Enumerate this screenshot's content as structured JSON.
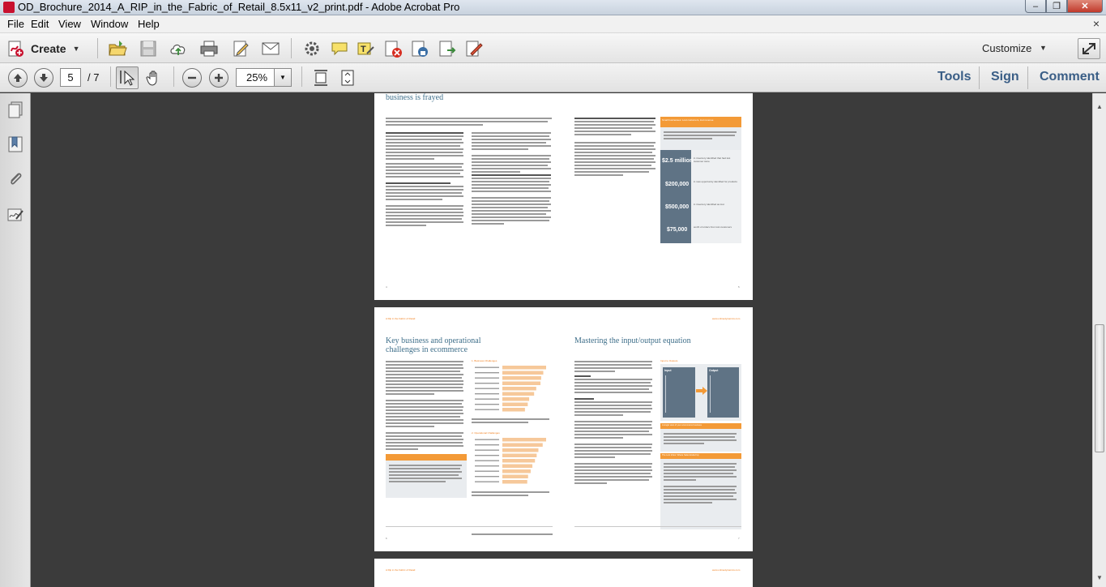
{
  "window": {
    "title": "OD_Brochure_2014_A_RIP_in_the_Fabric_of_Retail_8.5x11_v2_print.pdf - Adobe Acrobat Pro",
    "minimize": "–",
    "restore": "❐",
    "close": "✕"
  },
  "menu": {
    "items": [
      "File",
      "Edit",
      "View",
      "Window",
      "Help"
    ],
    "doc_close": "×"
  },
  "toolbar": {
    "create_label": "Create",
    "customize_label": "Customize",
    "caret": "▼"
  },
  "nav": {
    "page_current": "5",
    "page_total": "/ 7",
    "zoom": "25%",
    "zoom_caret": "▼",
    "panes": [
      "Tools",
      "Sign",
      "Comment"
    ]
  },
  "scrollbar": {
    "up": "▲",
    "down": "▼"
  },
  "document": {
    "spread1": {
      "left_title": "business is frayed",
      "left_folio": "4",
      "right_folio": "5",
      "sidebar_heading": "Small businesses: Lost customers, lost revenue",
      "stats": [
        {
          "value": "$2.5 million",
          "desc": "in inventory identified that had lost customer store"
        },
        {
          "value": "$200,000",
          "desc": "in new opportunity identified for products"
        },
        {
          "value": "$500,000",
          "desc": "in inventory identified as lost"
        },
        {
          "value": "$75,000",
          "desc": "worth of orders from lost customers"
        }
      ]
    },
    "spread2": {
      "running_head_left": "A Rip in the Fabric of Retail",
      "running_head_right": "www.onlinedynamics.com",
      "left_title_line1": "Key business and operational",
      "left_title_line2": "challenges in ecommerce",
      "right_title": "Mastering the input/output equation",
      "chart1_title": "1. Business Challenges",
      "chart1_values": [
        62,
        58,
        55,
        54,
        48,
        45,
        38,
        36,
        32
      ],
      "chart2_title": "2. Operational Challenges",
      "chart2_values": [
        51,
        47,
        42,
        40,
        38,
        35,
        33,
        30,
        29
      ],
      "diagram_title": "Input to Outputs",
      "diagram_input_label": "Input",
      "diagram_output_label": "Output",
      "box1_heading": "A single view of your ecommerce business",
      "box2_heading": "The Lost Inbox: Where Sales Ended Up",
      "left_folio": "6",
      "right_folio": "7"
    },
    "spread3": {
      "running_head_left": "A Rip in the Fabric of Retail",
      "running_head_right": "www.onlinedynamics.com"
    }
  },
  "colors": {
    "accent_orange": "#f39a37",
    "title_blue": "#3f6f8a",
    "panel_slate": "#5f7385",
    "pane_link": "#3a5e86"
  }
}
